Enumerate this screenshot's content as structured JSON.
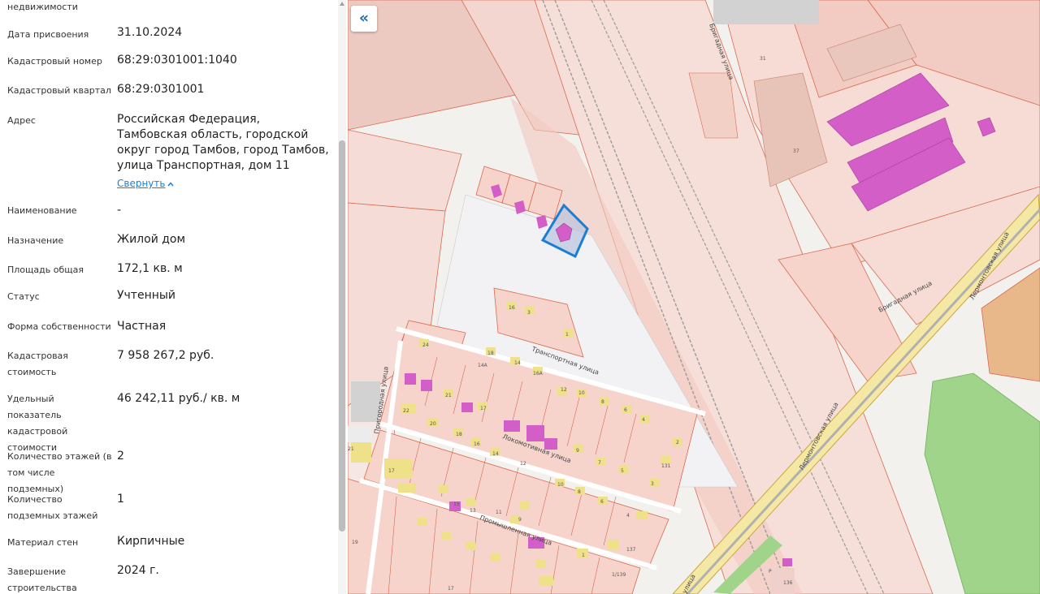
{
  "panel": {
    "top_cut_label": "недвижимости",
    "rows": [
      {
        "label": "Дата присвоения",
        "value": "31.10.2024"
      },
      {
        "label": "Кадастровый номер",
        "value": "68:29:0301001:1040"
      },
      {
        "label": "Кадастровый квартал",
        "value": "68:29:0301001"
      },
      {
        "label": "Адрес",
        "value": "Российская Федерация, Тамбовская область, городской округ город Тамбов, город Тамбов, улица Транспортная, дом 11"
      },
      {
        "label": "Наименование",
        "value": "-"
      },
      {
        "label": "Назначение",
        "value": "Жилой дом"
      },
      {
        "label": "Площадь общая",
        "value": "172,1 кв. м"
      },
      {
        "label": "Статус",
        "value": "Учтенный"
      },
      {
        "label": "Форма собственности",
        "value": "Частная"
      },
      {
        "label": "Кадастровая стоимость",
        "value": "7 958 267,2 руб."
      },
      {
        "label": "Удельный показатель кадастровой стоимости",
        "value": "46 242,11 руб./ кв. м"
      },
      {
        "label": "Количество этажей (в том числе подземных)",
        "value": "2"
      },
      {
        "label": "Количество подземных этажей",
        "value": "1"
      },
      {
        "label": "Материал стен",
        "value": "Кирпичные"
      },
      {
        "label": "Завершение строительства",
        "value": "2024 г."
      }
    ],
    "collapse_link": "Свернуть"
  },
  "map": {
    "toggle_icon": "«",
    "streets": {
      "brigadnaya_top": "Бригадная улица",
      "brigadnaya_bottom": "Бригадная улица",
      "lermontovskaya_a": "Лермонтовская улица",
      "lermontovskaya_b": "Лермонтовская улица",
      "lermontovskaya_c": "улица",
      "transportnaya": "Транспортная улица",
      "lokomotivnaya": "Локомотивная улица",
      "promyshlennaya": "Промышленная улица",
      "prigorodnaya": "Пригородная улица"
    },
    "parcel_numbers": [
      "16",
      "3",
      "1",
      "18",
      "14А",
      "14",
      "16А",
      "21",
      "17",
      "12",
      "10",
      "8",
      "6",
      "4",
      "2",
      "22",
      "20",
      "18",
      "16",
      "14",
      "12",
      "9",
      "7",
      "5",
      "131",
      "17",
      "15",
      "13",
      "11",
      "9",
      "10",
      "8",
      "6",
      "4",
      "3",
      "1",
      "1/139",
      "137",
      "19",
      "21",
      "17",
      "24",
      "37",
      "136",
      "31",
      "Р"
    ],
    "colors": {
      "parcel_fill": "#f6d4cc",
      "parcel_stroke": "#d8694f",
      "building_pink": "#d45ec8",
      "building_yellow": "#efe08a",
      "selected_outline": "#1a7fd4",
      "green_zone": "#9fd48a"
    }
  }
}
